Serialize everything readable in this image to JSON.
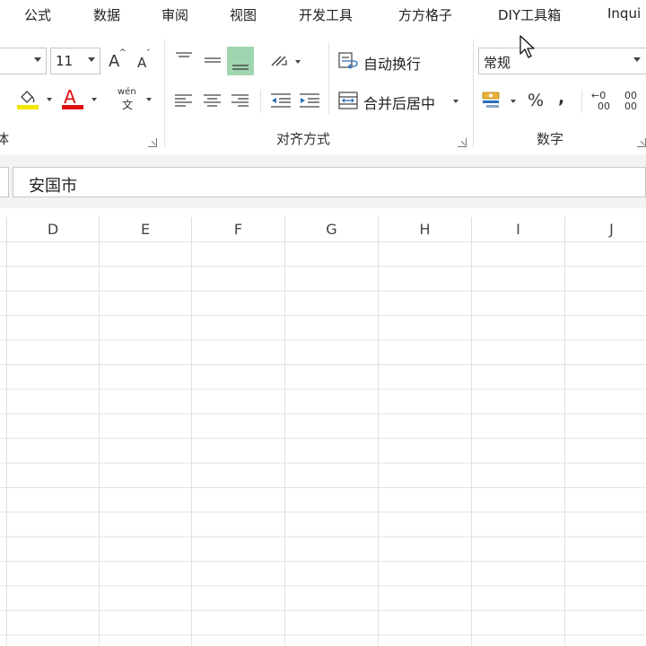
{
  "menu": {
    "items": [
      "公式",
      "数据",
      "审阅",
      "视图",
      "开发工具",
      "方方格子",
      "DIY工具箱",
      "Inqui"
    ]
  },
  "ribbon": {
    "font": {
      "size_value": "11",
      "grow_label": "A",
      "shrink_label": "A",
      "font_color_label": "A",
      "phonetic_top": "wén",
      "phonetic_bottom": "文",
      "group_label_partial": "体"
    },
    "alignment": {
      "wrap_text_label": "自动换行",
      "merge_center_label": "合并后居中",
      "group_label": "对齐方式"
    },
    "number": {
      "format_value": "常规",
      "percent_label": "%",
      "comma_label": ",",
      "increase_decimal_top": "←0",
      "increase_decimal_bottom": "00",
      "decrease_decimal_top": "00",
      "group_label": "数字"
    },
    "accent_colors": {
      "highlight": "#f2e600",
      "font_color": "#e01010",
      "active_align": "#9fd6b0"
    }
  },
  "formula_bar": {
    "value": "安国市"
  },
  "columns": [
    "D",
    "E",
    "F",
    "G",
    "H",
    "I",
    "J"
  ]
}
